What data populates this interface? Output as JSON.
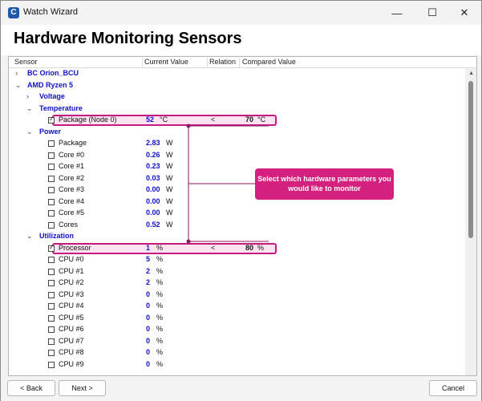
{
  "window": {
    "title": "Watch Wizard",
    "minimize": "—",
    "maximize": "☐",
    "close": "✕"
  },
  "page": {
    "title": "Hardware Monitoring Sensors"
  },
  "columns": {
    "sensor": "Sensor",
    "current": "Current Value",
    "relation": "Relation",
    "compared": "Compared Value"
  },
  "tree": {
    "bc": "BC Orion_BCU",
    "cpu": "AMD Ryzen 5",
    "voltage": "Voltage",
    "temperature": "Temperature",
    "power": "Power",
    "utilization": "Utilization"
  },
  "rows": [
    {
      "label": "Package (Node 0)",
      "value": "52",
      "unit": "°C",
      "relation": "<",
      "compared": "70",
      "compared_unit": "°C",
      "checked": true
    },
    {
      "label": "Package",
      "value": "2.83",
      "unit": "W"
    },
    {
      "label": "Core #0",
      "value": "0.26",
      "unit": "W"
    },
    {
      "label": "Core #1",
      "value": "0.23",
      "unit": "W"
    },
    {
      "label": "Core #2",
      "value": "0.03",
      "unit": "W"
    },
    {
      "label": "Core #3",
      "value": "0.00",
      "unit": "W"
    },
    {
      "label": "Core #4",
      "value": "0.00",
      "unit": "W"
    },
    {
      "label": "Core #5",
      "value": "0.00",
      "unit": "W"
    },
    {
      "label": "Cores",
      "value": "0.52",
      "unit": "W"
    },
    {
      "label": "Processor",
      "value": "1",
      "unit": "%",
      "relation": "<",
      "compared": "80",
      "compared_unit": "%",
      "checked": true
    },
    {
      "label": "CPU #0",
      "value": "5",
      "unit": "%"
    },
    {
      "label": "CPU #1",
      "value": "2",
      "unit": "%"
    },
    {
      "label": "CPU #2",
      "value": "2",
      "unit": "%"
    },
    {
      "label": "CPU #3",
      "value": "0",
      "unit": "%"
    },
    {
      "label": "CPU #4",
      "value": "0",
      "unit": "%"
    },
    {
      "label": "CPU #5",
      "value": "0",
      "unit": "%"
    },
    {
      "label": "CPU #6",
      "value": "0",
      "unit": "%"
    },
    {
      "label": "CPU #7",
      "value": "0",
      "unit": "%"
    },
    {
      "label": "CPU #8",
      "value": "0",
      "unit": "%"
    },
    {
      "label": "CPU #9",
      "value": "0",
      "unit": "%"
    }
  ],
  "callout": {
    "text": "Select which hardware parameters you would like to monitor",
    "color": "#d4207f"
  },
  "buttons": {
    "back": "< Back",
    "next": "Next >",
    "cancel": "Cancel"
  },
  "icons": {
    "app": "watch-wizard-app-icon",
    "tree_collapsed": "chevron-right-icon",
    "tree_expanded": "chevron-down-icon",
    "checkbox": "checkbox-icon"
  }
}
